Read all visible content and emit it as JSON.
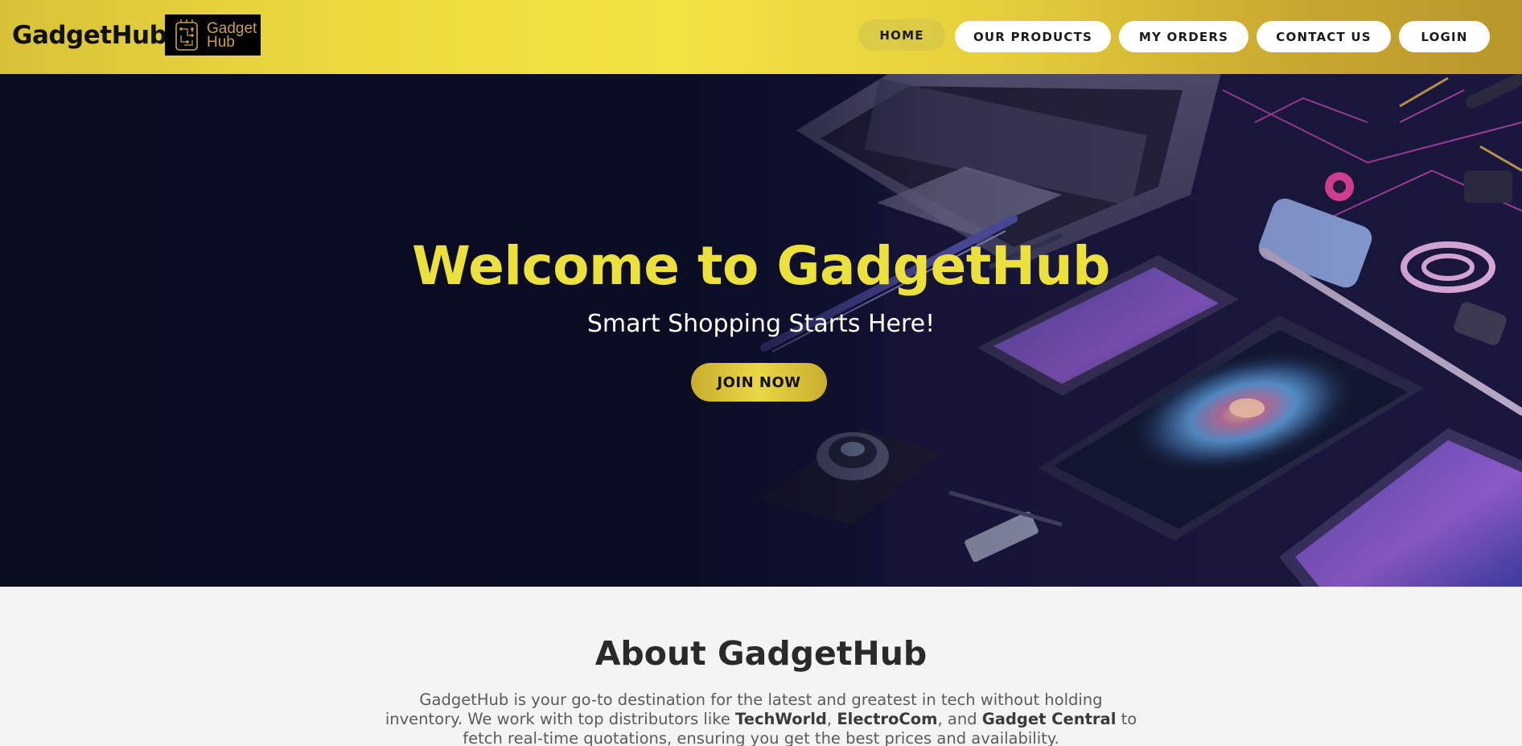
{
  "brand": {
    "name": "GadgetHub",
    "logo_text_line1": "Gadget",
    "logo_text_line2": "Hub"
  },
  "nav": {
    "items": [
      {
        "label": "HOME",
        "active": true
      },
      {
        "label": "OUR PRODUCTS",
        "active": false
      },
      {
        "label": "MY ORDERS",
        "active": false
      },
      {
        "label": "CONTACT US",
        "active": false
      },
      {
        "label": "LOGIN",
        "active": false
      }
    ]
  },
  "hero": {
    "title": "Welcome to GadgetHub",
    "subtitle": "Smart Shopping Starts Here!",
    "cta": "JOIN NOW"
  },
  "about": {
    "title": "About GadgetHub",
    "text_part1": "GadgetHub is your go-to destination for the latest and greatest in tech without holding inventory. We work with top distributors like ",
    "distributor1": "TechWorld",
    "sep1": ", ",
    "distributor2": "ElectroCom",
    "sep2": ", and ",
    "distributor3": "Gadget Central",
    "text_part2": " to fetch real-time quotations, ensuring you get the best prices and availability."
  },
  "colors": {
    "accent_yellow": "#ece03d",
    "header_gold": "#d8c237",
    "hero_bg": "#0b0e25",
    "about_bg": "#f4f4f4"
  },
  "icons": [
    "circuit-chip-logo"
  ]
}
